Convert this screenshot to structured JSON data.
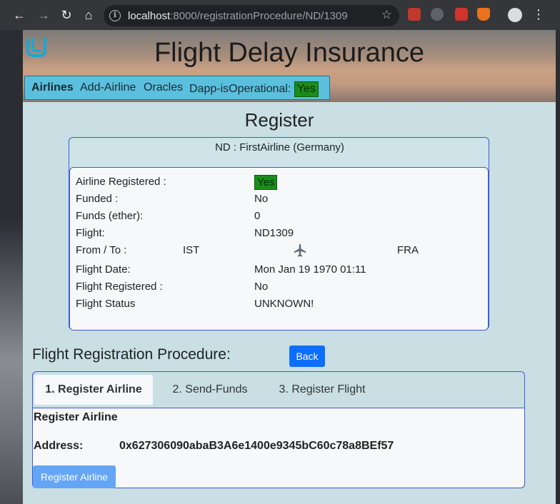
{
  "browser": {
    "url_host": "localhost",
    "url_path": ":8000/registrationProcedure/ND/1309"
  },
  "hero": {
    "title": "Flight Delay Insurance"
  },
  "nav": {
    "airlines": "Airlines",
    "add_airline": "Add-Airline",
    "oracles": "Oracles",
    "dapp_label": "Dapp-isOperational:",
    "dapp_status": "Yes"
  },
  "register": {
    "title": "Register",
    "airline_header": "ND : FirstAirline (Germany)",
    "rows": [
      {
        "label": "Airline Registered :",
        "value": "Yes"
      },
      {
        "label": "Funded :",
        "value": "No"
      },
      {
        "label": "Funds (ether):",
        "value": "0"
      },
      {
        "label": "Flight:",
        "value": "ND1309"
      },
      {
        "label": "From / To :",
        "from": "IST",
        "to": "FRA"
      },
      {
        "label": "Flight Date:",
        "value": "Mon Jan 19 1970 01:11"
      },
      {
        "label": "Flight Registered :",
        "value": "No"
      },
      {
        "label": "Flight Status",
        "value": "UNKNOWN!"
      }
    ]
  },
  "procedure": {
    "title": "Flight Registration Procedure:",
    "back_label": "Back",
    "tabs": [
      {
        "label": "1. Register Airline",
        "active": true
      },
      {
        "label": "2. Send-Funds",
        "active": false
      },
      {
        "label": "3. Register Flight",
        "active": false
      }
    ],
    "pane": {
      "heading": "Register Airline",
      "address_label": "Address:",
      "address_value": "0x627306090abaB3A6e1400e9345bC60c78a8BEf57",
      "button_label": "Register Airline"
    }
  },
  "colors": {
    "page_bg": "#c9dfe4",
    "nav_bg": "#5bc0de",
    "status_green": "#1a8c1a",
    "primary_button": "#0d6efd",
    "card_border": "#3b5bdb"
  }
}
